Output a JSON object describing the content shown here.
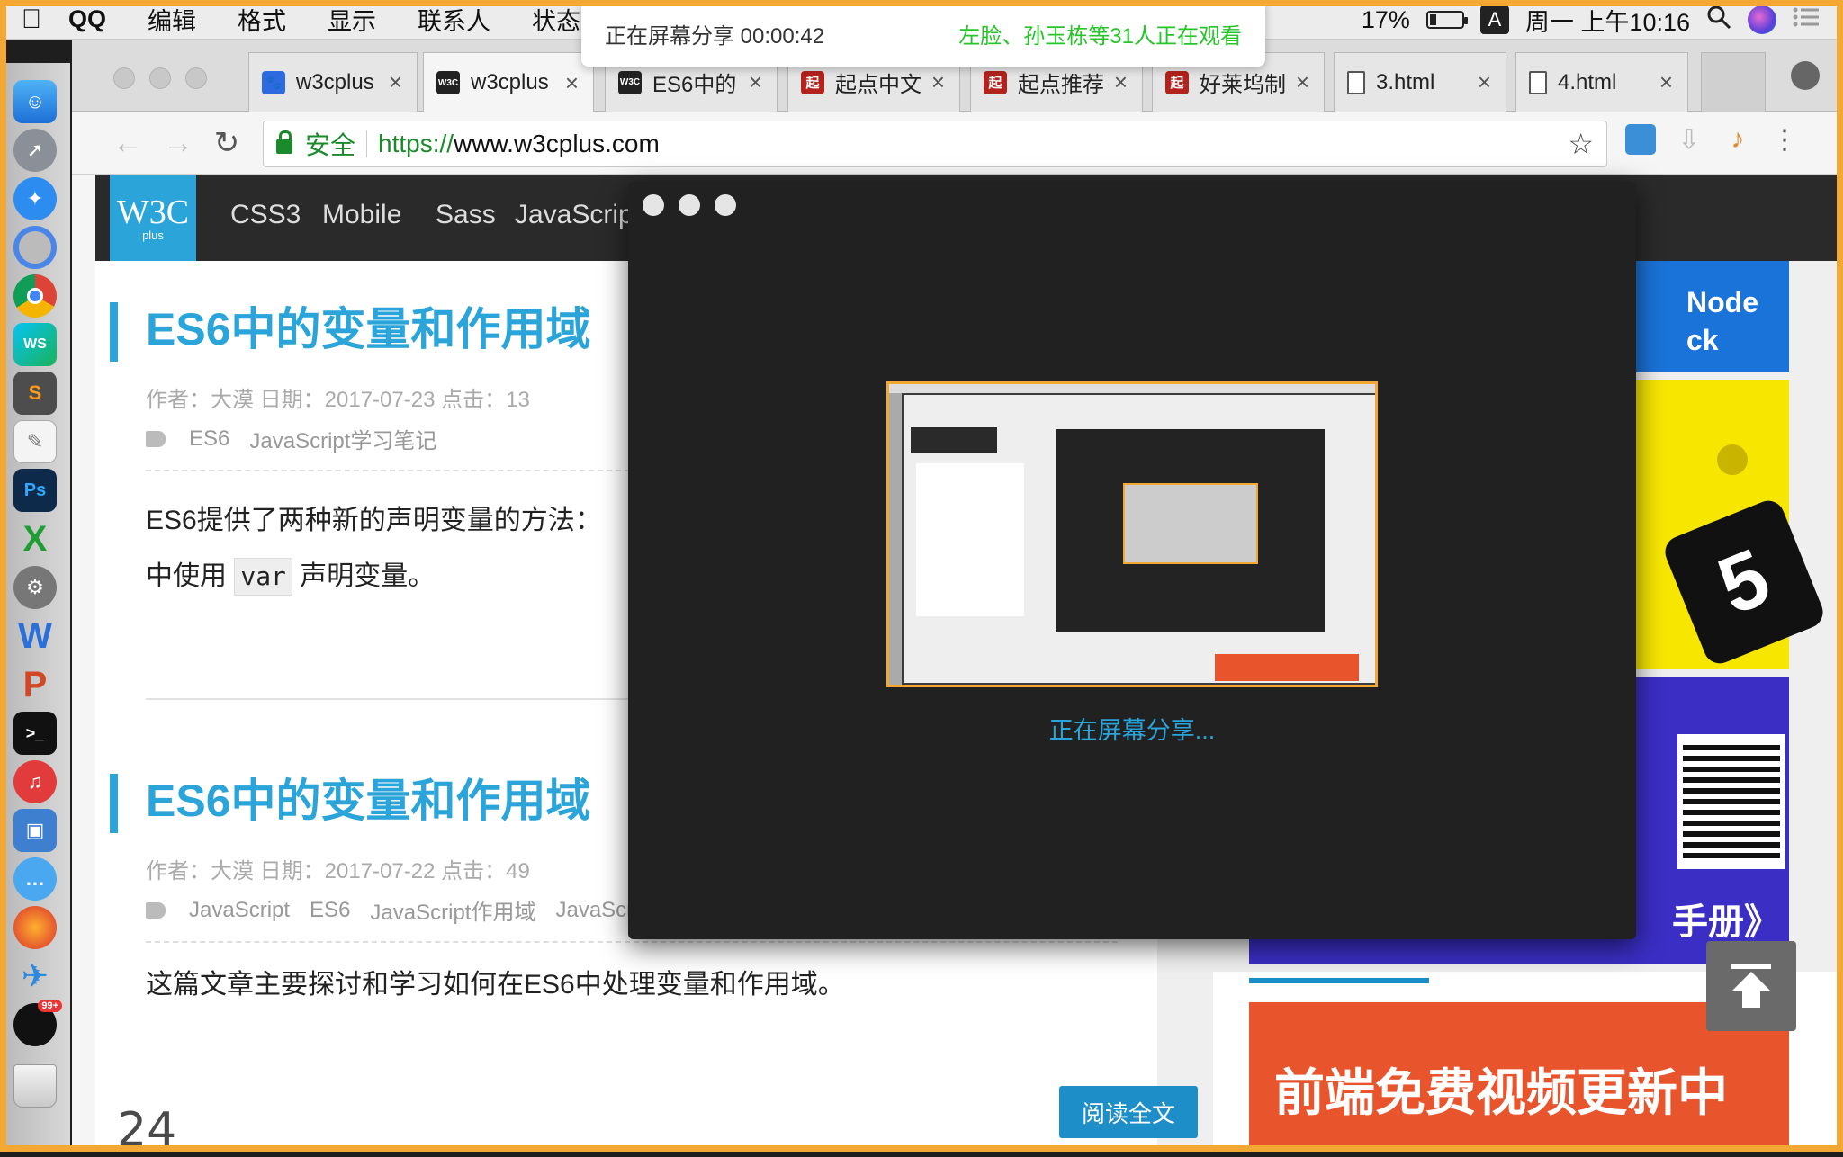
{
  "menubar": {
    "apple": "",
    "app_name": "QQ",
    "items": [
      "编辑",
      "格式",
      "显示",
      "联系人",
      "状态"
    ],
    "battery": "17%",
    "ime": "A",
    "clock": "周一 上午10:16"
  },
  "share_banner": {
    "status": "正在屏幕分享 00:00:42",
    "viewers": "左脸、孙玉栋等31人正在观看"
  },
  "browser": {
    "tabs": [
      {
        "title": "w3cplus",
        "favicon_color": "#2d6ae0",
        "favicon_text": ""
      },
      {
        "title": "w3cplus",
        "favicon_color": "#222222",
        "favicon_text": "W3C"
      },
      {
        "title": "ES6中的",
        "favicon_color": "#222222",
        "favicon_text": "W3C"
      },
      {
        "title": "起点中文",
        "favicon_color": "#b3221d",
        "favicon_text": "起"
      },
      {
        "title": "起点推荐",
        "favicon_color": "#b3221d",
        "favicon_text": "起"
      },
      {
        "title": "好莱坞制",
        "favicon_color": "#b3221d",
        "favicon_text": "起"
      },
      {
        "title": "3.html",
        "favicon_color": "#ffffff",
        "favicon_text": ""
      },
      {
        "title": "4.html",
        "favicon_color": "#ffffff",
        "favicon_text": ""
      }
    ],
    "close_glyph": "×",
    "secure_label": "安全",
    "url_scheme": "https://",
    "url_host": "www.w3cplus.com"
  },
  "site": {
    "logo": "W3C",
    "logo_sub": "plus",
    "nav": [
      "CSS3",
      "Mobile",
      "Sass",
      "JavaScript"
    ],
    "posts": [
      {
        "title": "ES6中的变量和作用域",
        "meta": "作者：大漠 日期：2017-07-23 点击：13",
        "tags": [
          "ES6",
          "JavaScript学习笔记"
        ],
        "excerpt_before": "ES6提供了两种新的声明变量的方法：",
        "excerpt_line2_before": "中使用",
        "excerpt_code": "var",
        "excerpt_line2_after": "声明变量。"
      },
      {
        "title": "ES6中的变量和作用域",
        "meta": "作者：大漠 日期：2017-07-22 点击：49",
        "tags": [
          "JavaScript",
          "ES6",
          "JavaScript作用域",
          "JavaScr"
        ],
        "excerpt_before": "这篇文章主要探讨和学习如何在ES6中处理变量和作用域。"
      }
    ],
    "read_more": "阅读全文",
    "sidebar_ad_text_1": "Node",
    "sidebar_ad_text_2": "ck",
    "sidebar_ad_text_3": "手册》",
    "sidebar_banner": "前端免费视频更新中"
  },
  "share_window": {
    "label": "正在屏幕分享..."
  },
  "bottom_text": "24",
  "colors": {
    "share_orange": "#f2a833",
    "w3c_blue": "#2aa4d9",
    "secure_green": "#1a8a2a",
    "viewer_green": "#27c42a"
  }
}
